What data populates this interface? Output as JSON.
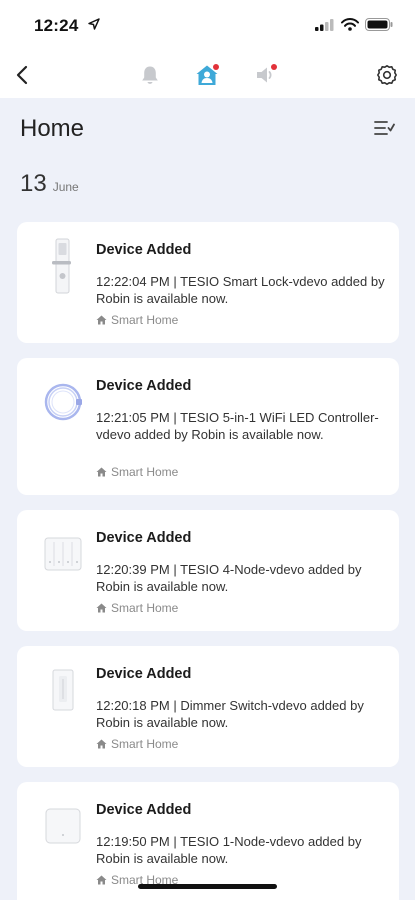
{
  "status": {
    "time": "12:24"
  },
  "nav": {
    "tabs": [
      {
        "icon": "bell-icon",
        "badge": false
      },
      {
        "icon": "home-person-icon",
        "badge": true,
        "active": true
      },
      {
        "icon": "speaker-icon",
        "badge": true
      }
    ]
  },
  "page": {
    "title": "Home"
  },
  "date_group": {
    "day": "13",
    "month": "June"
  },
  "cards": [
    {
      "title": "Device Added",
      "message": "12:22:04 PM | TESIO Smart Lock-vdevo added by  Robin  is available now.",
      "location": "Smart Home",
      "device_icon": "smart-lock-icon"
    },
    {
      "title": "Device Added",
      "message": "12:21:05 PM | TESIO 5-in-1 WiFi LED Controller-vdevo added by Robin  is available now.",
      "location": "Smart Home",
      "device_icon": "led-controller-icon"
    },
    {
      "title": "Device Added",
      "message": "12:20:39 PM | TESIO 4-Node-vdevo added by Robin  is available now.",
      "location": "Smart Home",
      "device_icon": "four-node-switch-icon"
    },
    {
      "title": "Device Added",
      "message": "12:20:18 PM | Dimmer Switch-vdevo added by Robin  is available now.",
      "location": "Smart Home",
      "device_icon": "dimmer-switch-icon"
    },
    {
      "title": "Device Added",
      "message": "12:19:50 PM | TESIO 1-Node-vdevo added by Robin  is available now.",
      "location": "Smart Home",
      "device_icon": "one-node-switch-icon"
    }
  ],
  "colors": {
    "accent": "#3fa9d8",
    "badge": "#e2323a",
    "background": "#eef1f9"
  }
}
